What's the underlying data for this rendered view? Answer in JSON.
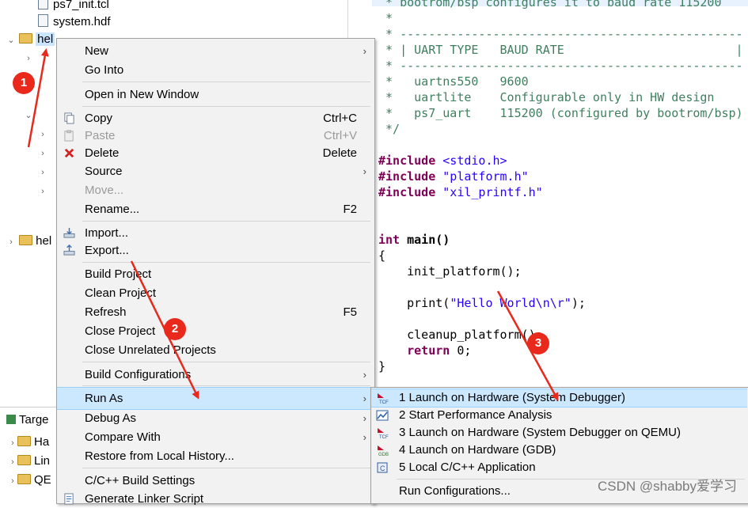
{
  "explorer": {
    "items": [
      {
        "label": "ps7_init.tcl"
      },
      {
        "label": "system.hdf"
      },
      {
        "label": "hel"
      },
      {
        "label": "hel"
      }
    ],
    "targets_label": "Targe",
    "target_items": [
      {
        "label": "Ha"
      },
      {
        "label": "Lin"
      },
      {
        "label": "QE"
      }
    ]
  },
  "editor": {
    "lines": [
      {
        "t": " * ",
        "c": "cmt",
        "extra": "bootrom/bsp configures it to baud rate 115200"
      },
      {
        "t": " *",
        "c": "cmt"
      },
      {
        "t": " * ------------------------------------------------",
        "c": "cmt"
      },
      {
        "t": " * | UART TYPE   BAUD RATE                        |",
        "c": "cmt"
      },
      {
        "t": " * ------------------------------------------------",
        "c": "cmt"
      },
      {
        "t": " *   uartns550   9600",
        "c": "cmt"
      },
      {
        "t": " *   uartlite    Configurable only in HW design",
        "c": "cmt"
      },
      {
        "t": " *   ps7_uart    115200 (configured by bootrom/bsp)",
        "c": "cmt"
      },
      {
        "t": " */",
        "c": "cmt"
      }
    ],
    "includes": [
      {
        "kw": "#include",
        "file": "<stdio.h>"
      },
      {
        "kw": "#include",
        "file": "\"platform.h\""
      },
      {
        "kw": "#include",
        "file": "\"xil_printf.h\""
      }
    ],
    "main_sig_kw": "int",
    "main_sig_rest": " main()",
    "brace_open": "{",
    "call1": "    init_platform();",
    "print_pre": "    print(",
    "print_str": "\"Hello World\\n\\r\"",
    "print_post": ");",
    "call2": "    cleanup_platform();",
    "ret_kw": "    return",
    "ret_rest": " 0;",
    "brace_close": "}"
  },
  "menu": {
    "items": [
      {
        "label": "New",
        "submenu": true
      },
      {
        "label": "Go Into"
      },
      {
        "label": "Open in New Window"
      },
      {
        "label": "Copy",
        "accel": "Ctrl+C"
      },
      {
        "label": "Paste",
        "accel": "Ctrl+V",
        "disabled": true
      },
      {
        "label": "Delete",
        "accel": "Delete"
      },
      {
        "label": "Source",
        "submenu": true
      },
      {
        "label": "Move...",
        "disabled": true
      },
      {
        "label": "Rename...",
        "accel": "F2"
      },
      {
        "label": "Import..."
      },
      {
        "label": "Export..."
      },
      {
        "label": "Build Project"
      },
      {
        "label": "Clean Project"
      },
      {
        "label": "Refresh",
        "accel": "F5"
      },
      {
        "label": "Close Project"
      },
      {
        "label": "Close Unrelated Projects"
      },
      {
        "label": "Build Configurations",
        "submenu": true
      },
      {
        "label": "Run As",
        "submenu": true,
        "highlighted": true
      },
      {
        "label": "Debug As",
        "submenu": true
      },
      {
        "label": "Compare With",
        "submenu": true
      },
      {
        "label": "Restore from Local History..."
      },
      {
        "label": "C/C++ Build Settings"
      },
      {
        "label": "Generate Linker Script"
      }
    ]
  },
  "run_as_submenu": {
    "items": [
      {
        "label": "1 Launch on Hardware (System Debugger)",
        "icon": "tcf-launch-icon",
        "highlighted": true
      },
      {
        "label": "2 Start Performance Analysis",
        "icon": "performance-chart-icon"
      },
      {
        "label": "3 Launch on Hardware (System Debugger on QEMU)",
        "icon": "tcf-launch-icon"
      },
      {
        "label": "4 Launch on Hardware (GDB)",
        "icon": "gdb-launch-icon"
      },
      {
        "label": "5 Local C/C++ Application",
        "icon": "c-application-icon"
      },
      {
        "label": "Run Configurations..."
      }
    ]
  },
  "annotations": {
    "badges": [
      {
        "label": "1"
      },
      {
        "label": "2"
      },
      {
        "label": "3"
      }
    ],
    "arrow_color": "#e8291c"
  },
  "watermark": "CSDN @shabby爱学习"
}
